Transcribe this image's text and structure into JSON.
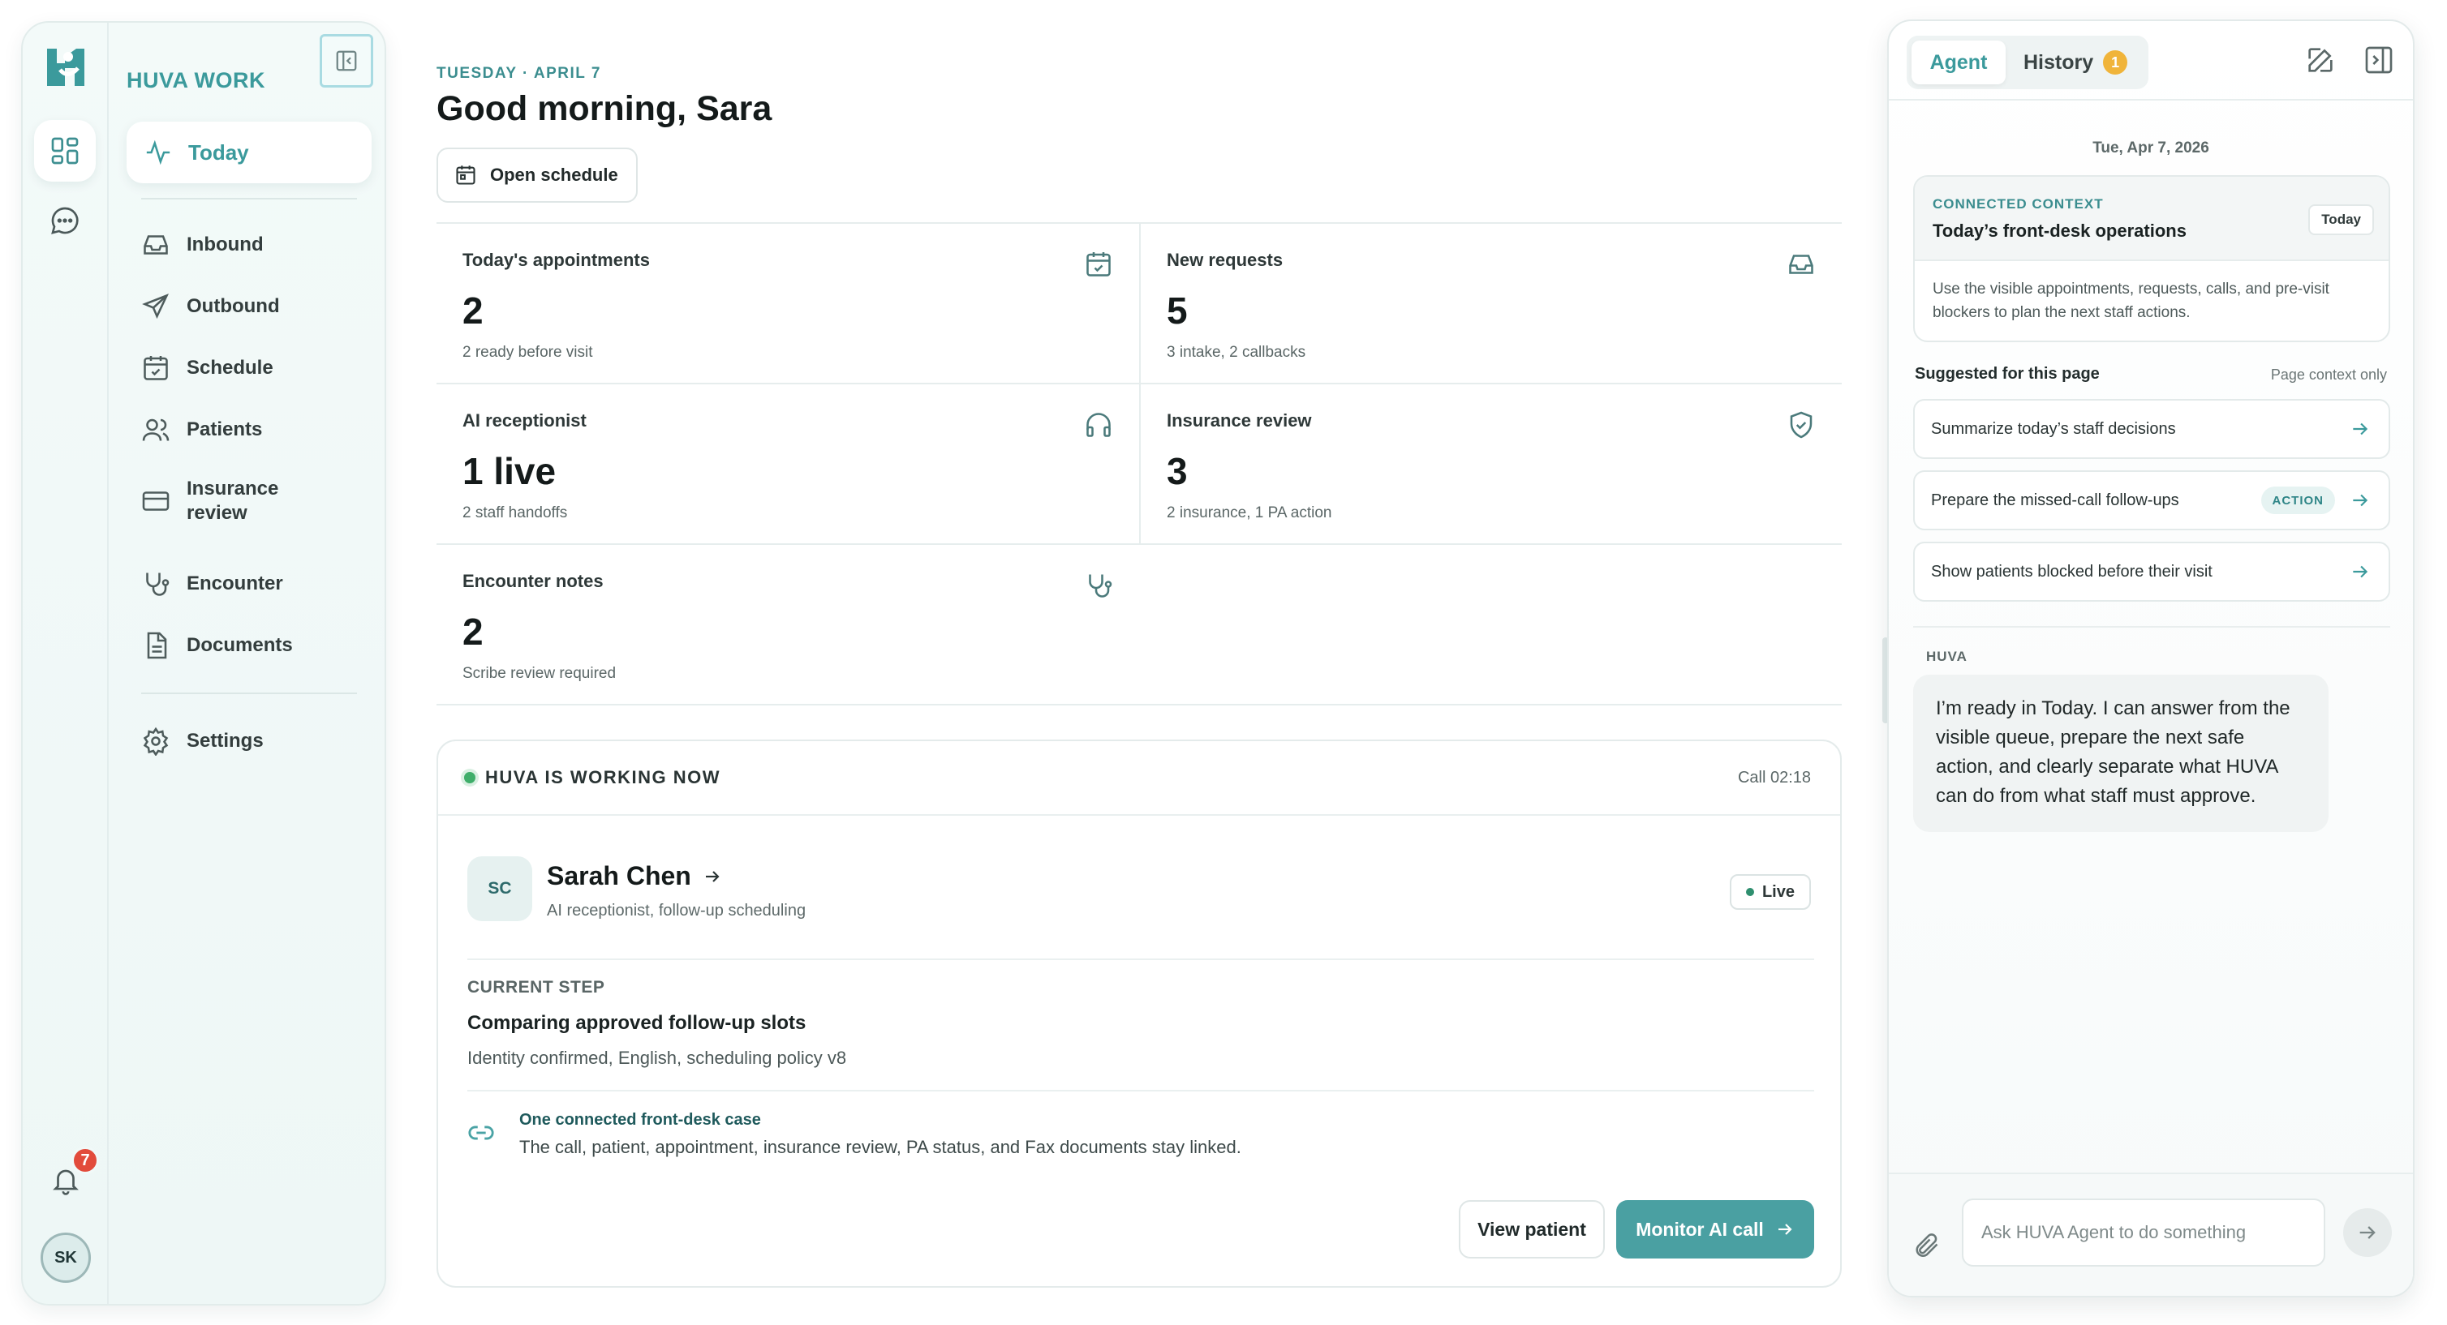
{
  "sidebar": {
    "brand": "HUVA WORK",
    "nav": {
      "today": "Today",
      "inbound": "Inbound",
      "outbound": "Outbound",
      "schedule": "Schedule",
      "patients": "Patients",
      "insurance_review": "Insurance review",
      "encounter": "Encounter",
      "documents": "Documents",
      "settings": "Settings"
    },
    "notifications_count": "7",
    "user_initials": "SK"
  },
  "header": {
    "date": "TUESDAY · APRIL 7",
    "greeting": "Good morning, Sara",
    "open_schedule": "Open schedule"
  },
  "stats": [
    {
      "title": "Today's appointments",
      "value": "2",
      "sub": "2 ready before visit",
      "icon": "calendar-check-icon"
    },
    {
      "title": "New requests",
      "value": "5",
      "sub": "3 intake, 2 callbacks",
      "icon": "inbox-icon"
    },
    {
      "title": "AI receptionist",
      "value": "1 live",
      "sub": "2 staff handoffs",
      "icon": "headphones-icon"
    },
    {
      "title": "Insurance review",
      "value": "3",
      "sub": "2 insurance, 1 PA action",
      "icon": "shield-check-icon"
    },
    {
      "title": "Encounter notes",
      "value": "2",
      "sub": "Scribe review required",
      "icon": "stethoscope-icon"
    }
  ],
  "working": {
    "title": "HUVA IS WORKING NOW",
    "call_time": "Call 02:18",
    "avatar": "SC",
    "name": "Sarah Chen",
    "role": "AI receptionist, follow-up scheduling",
    "status": "Live",
    "step_label": "CURRENT STEP",
    "step_title": "Comparing approved follow-up slots",
    "step_detail": "Identity confirmed, English, scheduling policy v8",
    "case_title": "One connected front-desk case",
    "case_desc": "The call, patient, appointment, insurance review, PA status, and Fax documents stay linked.",
    "view_patient": "View patient",
    "monitor": "Monitor AI call"
  },
  "agent": {
    "tab_agent": "Agent",
    "tab_history": "History",
    "history_count": "1",
    "date": "Tue, Apr 7, 2026",
    "context_label": "CONNECTED CONTEXT",
    "context_title": "Today’s front-desk operations",
    "context_pill": "Today",
    "context_body": "Use the visible appointments, requests, calls, and pre-visit blockers to plan the next staff actions.",
    "suggested_title": "Suggested for this page",
    "suggested_note": "Page context only",
    "suggestions": [
      {
        "text": "Summarize today’s staff decisions",
        "tag": ""
      },
      {
        "text": "Prepare the missed-call follow-ups",
        "tag": "ACTION"
      },
      {
        "text": "Show patients blocked before their visit",
        "tag": ""
      }
    ],
    "huva_label": "HUVA",
    "message": "I’m ready in Today. I can answer from the visible queue, prepare the next safe action, and clearly separate what HUVA can do from what staff must approve.",
    "input_placeholder": "Ask HUVA Agent to do something"
  },
  "colors": {
    "accent": "#3b9a9c",
    "button_primary": "#4aa0a2",
    "live_green": "#3fae6a",
    "badge_red": "#e24b3b",
    "badge_orange": "#f0b43a"
  }
}
